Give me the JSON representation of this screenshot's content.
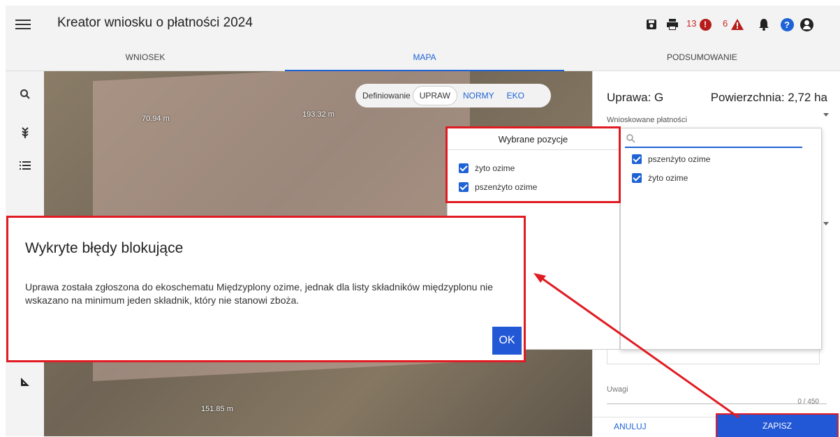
{
  "header": {
    "title": "Kreator wniosku o płatności 2024",
    "errors_count": "13",
    "warnings_count": "6"
  },
  "tabs": [
    {
      "label": "WNIOSEK"
    },
    {
      "label": "MAPA",
      "active": true
    },
    {
      "label": "PODSUMOWANIE"
    }
  ],
  "map": {
    "define_label": "Definiowanie",
    "segments": [
      "UPRAW",
      "NORMY",
      "EKO"
    ],
    "measurements": [
      "193.32 m",
      "70.94 m",
      "151.85 m"
    ]
  },
  "panel": {
    "crop": "Uprawa: G",
    "area": "Powierzchnia: 2,72 ha",
    "payments_label": "Wnioskowane płatności",
    "notes_label": "Uwagi",
    "notes_count": "0 / 450",
    "cancel": "ANULUJ",
    "save": "ZAPISZ"
  },
  "dropdown": {
    "options": [
      "pszenżyto ozime",
      "żyto ozime"
    ]
  },
  "selected": {
    "title": "Wybrane pozycje",
    "items": [
      "żyto ozime",
      "pszenżyto ozime"
    ]
  },
  "dialog": {
    "title": "Wykryte błędy blokujące",
    "message": "Uprawa została zgłoszona do ekoschematu Międzyplony ozime, jednak dla listy składników międzyplonu nie wskazano na minimum jeden składnik, który nie stanowi zboża.",
    "ok": "OK"
  },
  "colors": {
    "accent": "#2257d6",
    "highlight": "#e11b22",
    "error": "#b71c1c"
  }
}
